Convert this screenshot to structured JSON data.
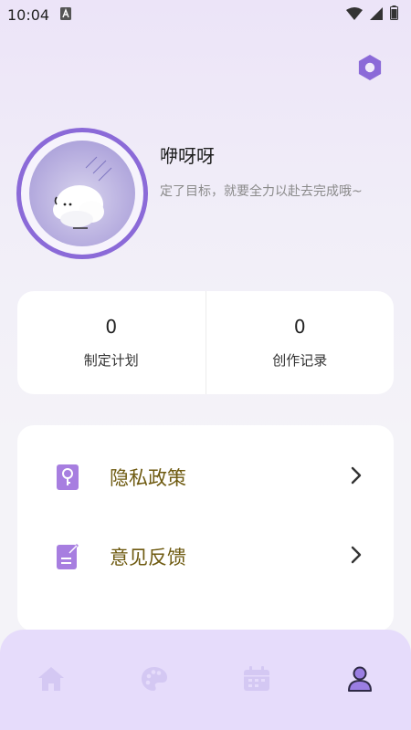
{
  "status_bar": {
    "time": "10:04"
  },
  "profile": {
    "username": "咿呀呀",
    "motto": "定了目标，就要全力以赴去完成哦~"
  },
  "stats": [
    {
      "value": "0",
      "label": "制定计划"
    },
    {
      "value": "0",
      "label": "创作记录"
    }
  ],
  "menu": [
    {
      "label": "隐私政策",
      "icon": "key-document-icon"
    },
    {
      "label": "意见反馈",
      "icon": "edit-note-icon"
    }
  ],
  "tabs": [
    {
      "name": "home",
      "icon": "home-icon",
      "active": false
    },
    {
      "name": "palette",
      "icon": "palette-icon",
      "active": false
    },
    {
      "name": "calendar",
      "icon": "calendar-icon",
      "active": false
    },
    {
      "name": "profile",
      "icon": "user-icon",
      "active": true
    }
  ],
  "colors": {
    "accent": "#8b6ad8",
    "menu_text": "#6e5a10",
    "tab_bar": "#e6dcfb",
    "tab_inactive": "#d7ccf4",
    "tab_active": "#2e2a45"
  }
}
